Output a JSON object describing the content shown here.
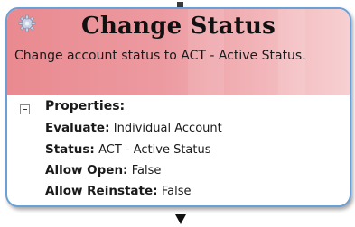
{
  "node": {
    "title": "Change Status",
    "description": "Change account status to ACT - Active Status.",
    "properties_heading": "Properties:",
    "properties": [
      {
        "key": "Evaluate:",
        "value": "Individual Account"
      },
      {
        "key": "Status:",
        "value": "ACT - Active Status"
      },
      {
        "key": "Allow Open:",
        "value": "False"
      },
      {
        "key": "Allow Reinstate:",
        "value": "False"
      }
    ]
  },
  "colors": {
    "header_start": "#e98a90",
    "header_end": "#f7d0d2",
    "border": "#6aa0d8"
  },
  "icons": {
    "node_icon": "gear-icon",
    "collapse_toggle": "minus-box-icon",
    "input_connector": "square-connector-icon",
    "output_connector": "down-arrow-icon"
  }
}
